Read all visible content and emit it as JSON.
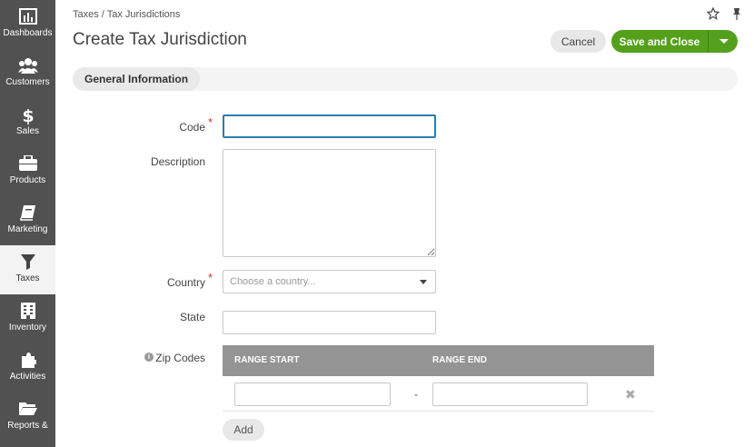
{
  "sidebar": {
    "items": [
      {
        "label": "Dashboards",
        "icon": "dashboards-icon"
      },
      {
        "label": "Customers",
        "icon": "customers-icon"
      },
      {
        "label": "Sales",
        "icon": "dollar-icon"
      },
      {
        "label": "Products",
        "icon": "briefcase-icon"
      },
      {
        "label": "Marketing",
        "icon": "book-icon"
      },
      {
        "label": "Taxes",
        "icon": "filter-icon",
        "active": true
      },
      {
        "label": "Inventory",
        "icon": "building-icon"
      },
      {
        "label": "Activities",
        "icon": "puzzle-icon"
      },
      {
        "label": "Reports &",
        "icon": "folder-icon"
      }
    ],
    "active_color": "#f3f3f3"
  },
  "header": {
    "breadcrumb": "Taxes / Tax Jurisdictions",
    "title": "Create Tax Jurisdiction",
    "cancel_label": "Cancel",
    "save_label": "Save and Close",
    "accent": "#54a01d"
  },
  "section": {
    "tab_label": "General Information"
  },
  "form": {
    "code_label": "Code",
    "code_value": "",
    "description_label": "Description",
    "description_value": "",
    "country_label": "Country",
    "country_placeholder": "Choose a country...",
    "state_label": "State",
    "state_value": "",
    "zip_label": "Zip Codes",
    "zip_table": {
      "headers": [
        "RANGE START",
        "RANGE END"
      ],
      "rows": [
        {
          "start": "",
          "end": ""
        }
      ]
    },
    "range_separator": "-",
    "remove_glyph": "✖",
    "add_label": "Add",
    "required_mark": "*"
  }
}
